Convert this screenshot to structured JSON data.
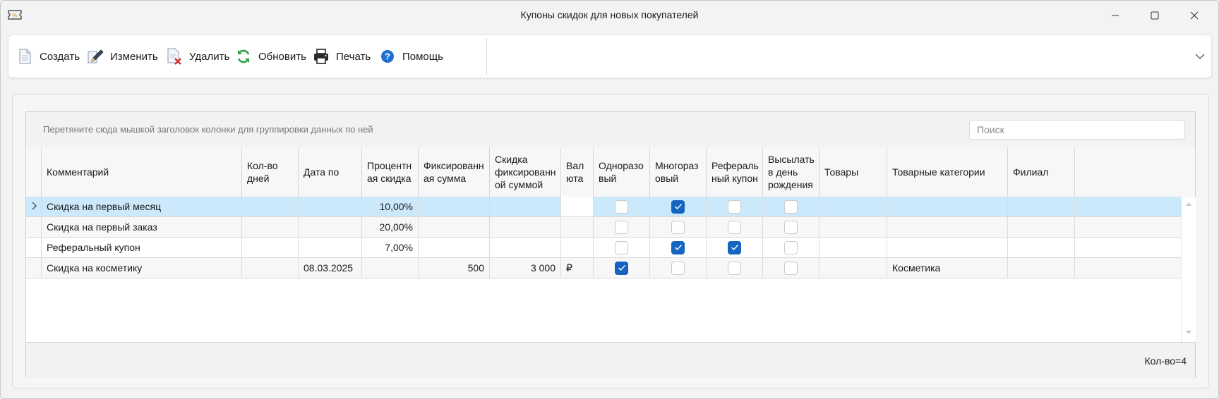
{
  "window": {
    "title": "Купоны скидок для новых покупателей"
  },
  "toolbar": {
    "create": "Создать",
    "edit": "Изменить",
    "delete": "Удалить",
    "refresh": "Обновить",
    "print": "Печать",
    "help": "Помощь"
  },
  "grid": {
    "group_hint": "Перетяните сюда мышкой заголовок колонки для группировки данных по ней",
    "search_placeholder": "Поиск",
    "columns": [
      {
        "key": "comment",
        "label": "Комментарий"
      },
      {
        "key": "days",
        "label": "Кол-во дней"
      },
      {
        "key": "date_to",
        "label": "Дата по"
      },
      {
        "key": "percent",
        "label": "Процентная скидка"
      },
      {
        "key": "fixed_sum",
        "label": "Фиксированная сумма"
      },
      {
        "key": "fixed_discount",
        "label": "Скидка фиксированной суммой"
      },
      {
        "key": "currency",
        "label": "Валюта"
      },
      {
        "key": "single_use",
        "label": "Одноразовый"
      },
      {
        "key": "multi_use",
        "label": "Многоразовый"
      },
      {
        "key": "referral",
        "label": "Реферальный купон"
      },
      {
        "key": "birthday",
        "label": "Высылать в день рождения"
      },
      {
        "key": "goods",
        "label": "Товары"
      },
      {
        "key": "categories",
        "label": "Товарные категории"
      },
      {
        "key": "branch",
        "label": "Филиал"
      }
    ],
    "header_lines": {
      "comment": [
        "Комментарий"
      ],
      "days": [
        "Кол-во",
        "дней"
      ],
      "date_to": [
        "Дата по"
      ],
      "percent": [
        "Процентн",
        "ая скидка"
      ],
      "fixed_sum": [
        "Фиксированн",
        "ая сумма"
      ],
      "fixed_discount": [
        "Скидка",
        "фиксированн",
        "ой суммой"
      ],
      "currency": [
        "Вал",
        "юта"
      ],
      "single_use": [
        "Одноразо",
        "вый"
      ],
      "multi_use": [
        "Многораз",
        "овый"
      ],
      "referral": [
        "Рефераль",
        "ный купон"
      ],
      "birthday": [
        "Высылать",
        "в день",
        "рождения"
      ],
      "goods": [
        "Товары"
      ],
      "categories": [
        "Товарные категории"
      ],
      "branch": [
        "Филиал"
      ]
    },
    "rows": [
      {
        "comment": "Скидка на первый месяц",
        "days": "",
        "date_to": "",
        "percent": "10,00%",
        "fixed_sum": "",
        "fixed_discount": "",
        "currency": "",
        "single_use": false,
        "multi_use": true,
        "referral": false,
        "birthday": false,
        "goods": "",
        "categories": "",
        "branch": ""
      },
      {
        "comment": "Скидка на первый заказ",
        "days": "",
        "date_to": "",
        "percent": "20,00%",
        "fixed_sum": "",
        "fixed_discount": "",
        "currency": "",
        "single_use": false,
        "multi_use": false,
        "referral": false,
        "birthday": false,
        "goods": "",
        "categories": "",
        "branch": ""
      },
      {
        "comment": "Реферальный  купон",
        "days": "",
        "date_to": "",
        "percent": "7,00%",
        "fixed_sum": "",
        "fixed_discount": "",
        "currency": "",
        "single_use": false,
        "multi_use": true,
        "referral": true,
        "birthday": false,
        "goods": "",
        "categories": "",
        "branch": ""
      },
      {
        "comment": "Скидка на косметику",
        "days": "",
        "date_to": "08.03.2025",
        "percent": "",
        "fixed_sum": "500",
        "fixed_discount": "3 000",
        "currency": "₽",
        "single_use": true,
        "multi_use": false,
        "referral": false,
        "birthday": false,
        "goods": "",
        "categories": "Косметика",
        "branch": ""
      }
    ],
    "selected_row": 0,
    "footer_count": "Кол-во=4"
  },
  "icons": {
    "app": "coupon-icon",
    "create": "new-document-icon",
    "edit": "edit-pen-icon",
    "delete": "delete-document-icon",
    "refresh": "refresh-icon",
    "print": "printer-icon",
    "help": "help-icon"
  },
  "colors": {
    "accent": "#1565c0",
    "selection": "#cce8fb",
    "refresh": "#2e9e3e",
    "delete": "#d32f2f",
    "help": "#1e6fd0"
  }
}
